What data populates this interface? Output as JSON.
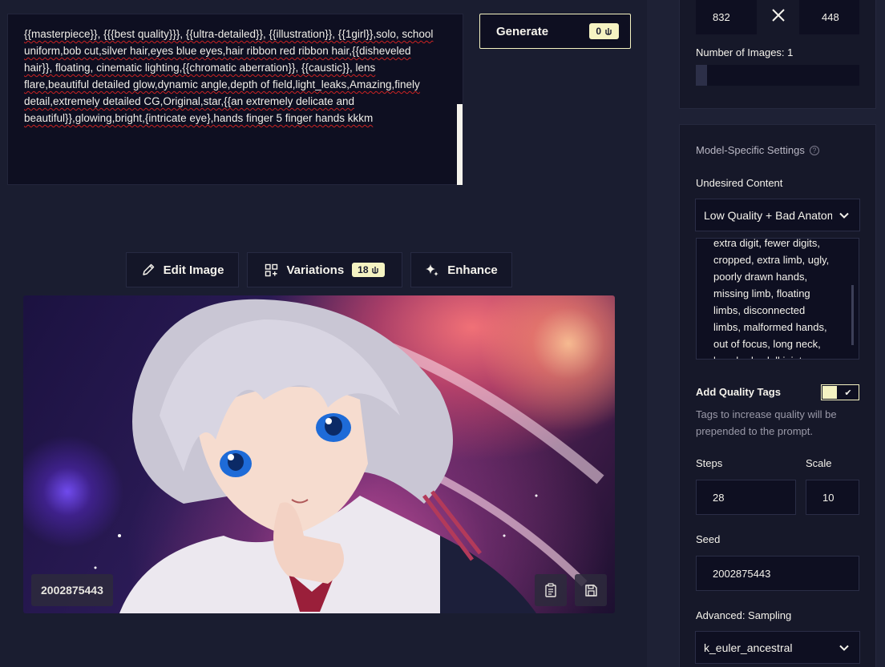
{
  "prompt": {
    "text": "{{masterpiece}}, {{{best quality}}}, {{ultra-detailed}}, {{illustration}}, {{1girl}},solo, school uniform,bob cut,silver hair,eyes blue eyes,hair ribbon red ribbon hair,{{disheveled hair}}, floating,  cinematic lighting,{{chromatic aberration}}, {{caustic}}, lens flare,beautiful detailed glow,dynamic angle,depth of field,light_leaks,Amazing,finely detail,extremely detailed CG,Original,star,{{an extremely delicate and beautiful}},glowing,bright,{intricate eye},hands finger 5 finger hands kkkm"
  },
  "generate": {
    "label": "Generate",
    "cost": "0"
  },
  "actions": {
    "edit_label": "Edit Image",
    "variations_label": "Variations",
    "variations_cost": "18",
    "enhance_label": "Enhance"
  },
  "image": {
    "seed": "2002875443"
  },
  "settings": {
    "width": "832",
    "height": "448",
    "num_images_label": "Number of Images:",
    "num_images_value": "1",
    "num_images": 1,
    "section_title": "Model-Specific Settings",
    "undesired_label": "Undesired Content",
    "undesired_preset": "Low Quality + Bad Anatomy",
    "undesired_text": "extra digit, fewer digits, cropped, extra limb, ugly, poorly drawn hands, missing limb, floating limbs, disconnected limbs, malformed hands, out of focus, long neck, long body, doll joint",
    "quality_tags_label": "Add Quality Tags",
    "quality_tags_on": true,
    "quality_tags_desc": "Tags to increase quality will be prepended to the prompt.",
    "steps_label": "Steps",
    "steps": "28",
    "scale_label": "Scale",
    "scale": "10",
    "seed_label": "Seed",
    "seed": "2002875443",
    "sampling_label": "Advanced: Sampling",
    "sampler": "k_euler_ancestral"
  },
  "colors": {
    "background": "#1a1d30",
    "accent": "#f5f3c2",
    "panel": "#161829",
    "input": "#0e0f21"
  }
}
